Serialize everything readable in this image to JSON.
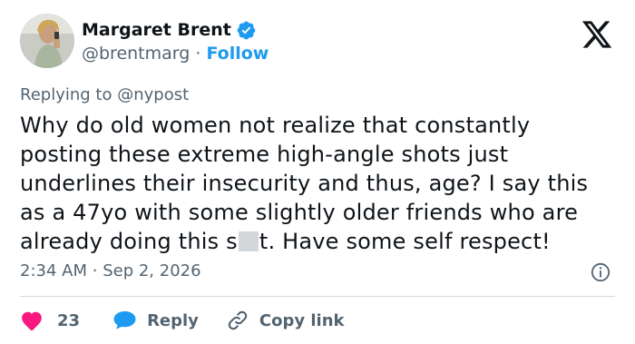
{
  "author": {
    "name": "Margaret Brent",
    "handle": "@brentmarg",
    "separator": "·",
    "follow_label": "Follow",
    "verified_color": "#1d9bf0"
  },
  "reply_context": {
    "prefix": "Replying to",
    "mention": "@nypost"
  },
  "tweet": {
    "lines": [
      "Why do old women not realize that constantly",
      "posting these extreme high-angle shots just",
      "underlines their insecurity and thus, age? I say this",
      "as a 47yo with some slightly older friends who are"
    ],
    "last_line_before_censor": "already doing this s",
    "last_line_after_censor": "t. Have some self respect!"
  },
  "meta": {
    "time": "2:34 AM",
    "separator": "·",
    "date": "Sep 2, 2026"
  },
  "actions": {
    "like_count": "23",
    "reply_label": "Reply",
    "copy_link_label": "Copy link"
  },
  "colors": {
    "accent": "#1d9bf0",
    "like": "#f91880",
    "secondary_text": "#536471",
    "primary_text": "#0f1419",
    "divider": "#cfd9de"
  },
  "icons": {
    "verified": "verified-badge-icon",
    "logo": "x-logo-icon",
    "info": "info-icon",
    "like": "heart-icon",
    "reply": "speech-bubble-icon",
    "copy": "link-icon"
  }
}
